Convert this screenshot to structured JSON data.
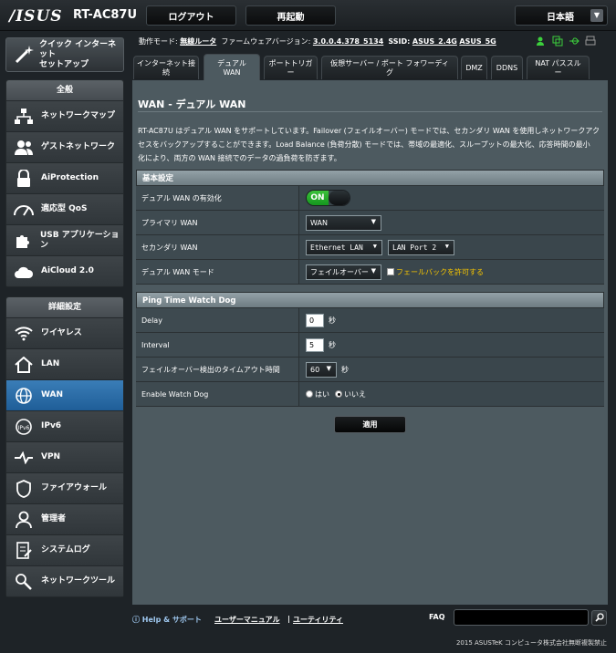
{
  "header": {
    "logo": "/ISUS",
    "model": "RT-AC87U",
    "logout_label": "ログアウト",
    "reboot_label": "再起動",
    "language": "日本語"
  },
  "quick_setup": {
    "label_line1": "クイック インターネット",
    "label_line2": "セットアップ"
  },
  "nav_general": {
    "heading": "全般",
    "items": [
      {
        "label": "ネットワークマップ",
        "icon": "network-map-icon"
      },
      {
        "label": "ゲストネットワーク",
        "icon": "guest-network-icon"
      },
      {
        "label": "AiProtection",
        "icon": "lock-icon"
      },
      {
        "label": "適応型 QoS",
        "icon": "gauge-icon"
      },
      {
        "label": "USB アプリケーション",
        "icon": "puzzle-icon"
      },
      {
        "label": "AiCloud 2.0",
        "icon": "cloud-icon"
      }
    ]
  },
  "nav_advanced": {
    "heading": "詳細設定",
    "items": [
      {
        "label": "ワイヤレス",
        "icon": "wifi-icon"
      },
      {
        "label": "LAN",
        "icon": "home-icon"
      },
      {
        "label": "WAN",
        "icon": "globe-icon"
      },
      {
        "label": "IPv6",
        "icon": "ipv6-icon"
      },
      {
        "label": "VPN",
        "icon": "vpn-icon"
      },
      {
        "label": "ファイアウォール",
        "icon": "shield-icon"
      },
      {
        "label": "管理者",
        "icon": "user-icon"
      },
      {
        "label": "システムログ",
        "icon": "log-icon"
      },
      {
        "label": "ネットワークツール",
        "icon": "tools-icon"
      }
    ]
  },
  "status": {
    "mode_label": "動作モード:",
    "mode_value": "無線ルータ",
    "fw_label": "ファームウェアバージョン:",
    "fw_value": "3.0.0.4.378_5134",
    "ssid_label": "SSID:",
    "ssid_1": "ASUS_2.4G",
    "ssid_2": "ASUS_5G"
  },
  "tabs": [
    {
      "line1": "インターネット接",
      "line2": "続"
    },
    {
      "line1": "デュアル",
      "line2": "WAN"
    },
    {
      "line1": "ポートトリガ",
      "line2": "ー"
    },
    {
      "line1": "仮想サーバー / ポート フォワーディ",
      "line2": "グ"
    },
    {
      "line1": "DMZ",
      "line2": ""
    },
    {
      "line1": "DDNS",
      "line2": ""
    },
    {
      "line1": "NAT パススル",
      "line2": "ー"
    }
  ],
  "page": {
    "title": "WAN - デュアル WAN",
    "desc1": "RT-AC87U はデュアル WAN をサポートしています。Failover (フェイルオーバー) モードでは、セカンダリ WAN を使用しネットワークアク",
    "desc2": "セスをバックアップすることができます。Load Balance (負荷分散) モードでは、帯域の最適化、スループットの最大化、応答時間の最小",
    "desc3": "化により、両方の WAN 接続でのデータの過負荷を防ぎます。"
  },
  "basic": {
    "heading": "基本設定",
    "enable_label": "デュアル WAN の有効化",
    "enable_state": "ON",
    "primary_label": "プライマリ WAN",
    "primary_value": "WAN",
    "secondary_label": "セカンダリ WAN",
    "secondary_value": "Ethernet LAN",
    "secondary_port": "LAN Port 2",
    "mode_label": "デュアル WAN モード",
    "mode_value": "フェイルオーバー",
    "fallback_label": "フェールバックを許可する"
  },
  "ping": {
    "heading": "Ping Time Watch Dog",
    "delay_label": "Delay",
    "delay_value": "0",
    "interval_label": "Interval",
    "interval_value": "5",
    "timeout_label": "フェイルオーバー検出のタイムアウト時間",
    "timeout_value": "60",
    "unit": "秒",
    "watchdog_label": "Enable Watch Dog",
    "yes_label": "はい",
    "no_label": "いいえ"
  },
  "apply_label": "適用",
  "footer": {
    "help": "Help & サポート",
    "manual": "ユーザーマニュアル",
    "utility": "ユーティリティ",
    "faq": "FAQ",
    "copyright": "2015 ASUSTeK コンピュータ株式会社無断複製禁止"
  },
  "colors": {
    "accent": "#1f5e98",
    "on": "#14961d",
    "panel": "#4d5a60",
    "warn": "#f5c400"
  }
}
